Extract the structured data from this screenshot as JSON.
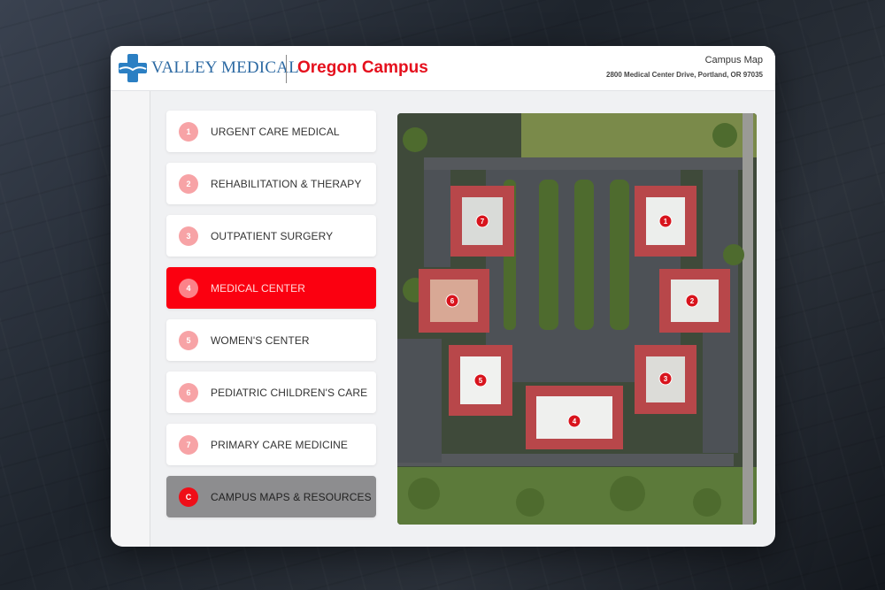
{
  "header": {
    "brand": "VALLEY MEDICAL",
    "campus": "Oregon Campus",
    "page_title": "Campus Map",
    "address": "2800 Medical Center Drive, Portland, OR 97035"
  },
  "colors": {
    "accent": "#e5101d",
    "brand_blue": "#2d6aa3",
    "active_bg": "#fb0010",
    "resources_bg": "#8d8d8f"
  },
  "menu": [
    {
      "num": "1",
      "label": "URGENT CARE MEDICAL"
    },
    {
      "num": "2",
      "label": "REHABILITATION & THERAPY"
    },
    {
      "num": "3",
      "label": "OUTPATIENT SURGERY"
    },
    {
      "num": "4",
      "label": "MEDICAL CENTER",
      "active": true
    },
    {
      "num": "5",
      "label": "WOMEN'S CENTER"
    },
    {
      "num": "6",
      "label": "PEDIATRIC CHILDREN'S CARE"
    },
    {
      "num": "7",
      "label": "PRIMARY CARE MEDICINE"
    },
    {
      "num": "C",
      "label": "CAMPUS MAPS & RESOURCES"
    }
  ],
  "map": {
    "markers": [
      "1",
      "2",
      "3",
      "4",
      "5",
      "6",
      "7"
    ]
  }
}
